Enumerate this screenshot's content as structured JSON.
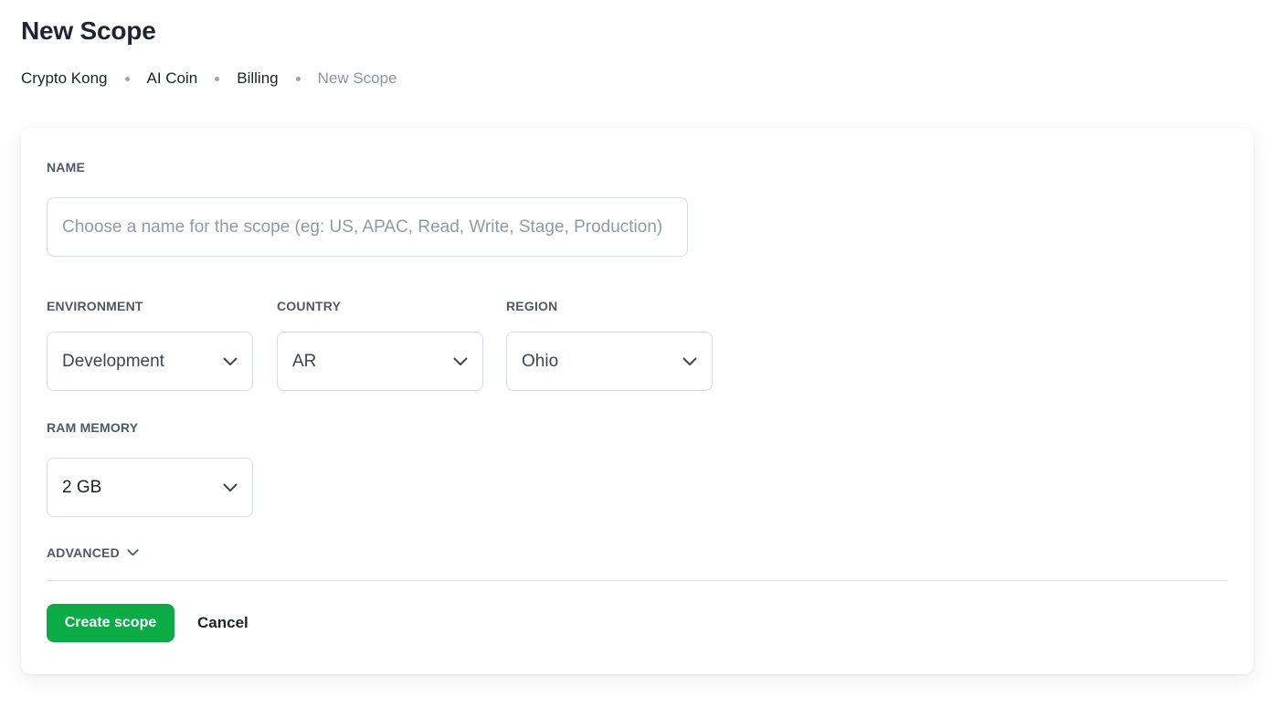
{
  "page": {
    "title": "New Scope"
  },
  "breadcrumb": [
    "Crypto Kong",
    "AI Coin",
    "Billing",
    "New Scope"
  ],
  "form": {
    "name": {
      "label": "NAME",
      "value": "",
      "placeholder": "Choose a name for the scope (eg: US, APAC, Read, Write, Stage, Production)"
    },
    "environment": {
      "label": "ENVIRONMENT",
      "value": "Development"
    },
    "country": {
      "label": "COUNTRY",
      "value": "AR"
    },
    "region": {
      "label": "REGION",
      "value": "Ohio"
    },
    "ram_memory": {
      "label": "RAM MEMORY",
      "value": "2 GB"
    },
    "advanced_label": "ADVANCED"
  },
  "actions": {
    "create_label": "Create scope",
    "cancel_label": "Cancel"
  },
  "colors": {
    "primary": "#0bab46",
    "text": "#1b2128",
    "muted": "#8a949e",
    "border": "#d7dce1"
  },
  "icons": {
    "dropdown": "chevron-down-icon",
    "separator": "dot-separator"
  }
}
